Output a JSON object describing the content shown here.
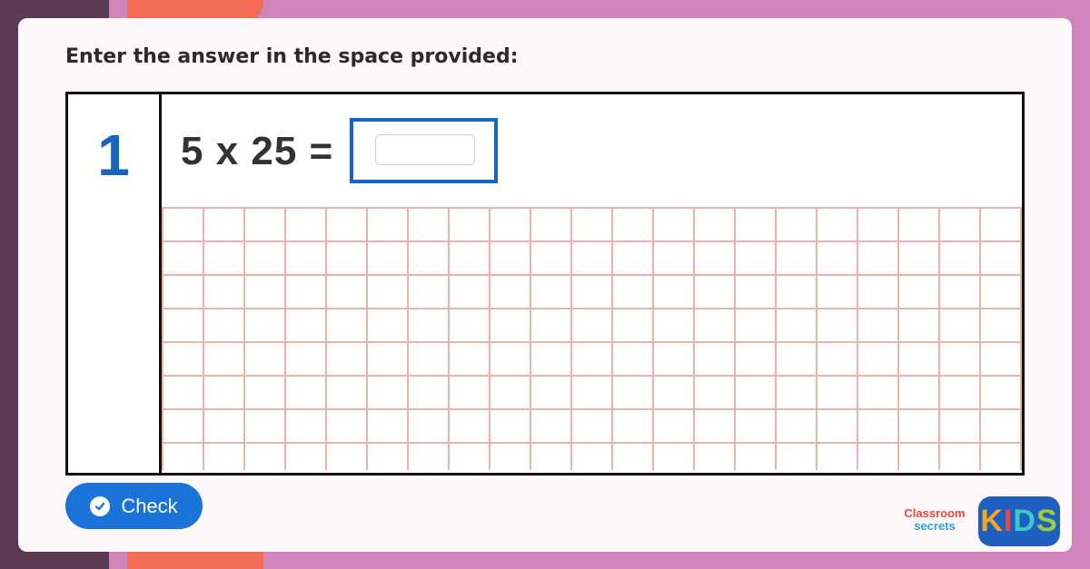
{
  "prompt": "Enter the answer in the space provided:",
  "question": {
    "number": "1",
    "equation": "5 x 25 =",
    "answer_value": "",
    "answer_placeholder": ""
  },
  "check_button": {
    "label": "Check",
    "icon": "check-circle-icon"
  },
  "logo": {
    "line1": "Classroom",
    "line2": "secrets",
    "kids_letters": [
      "K",
      "I",
      "D",
      "S"
    ]
  },
  "colors": {
    "background": "#d084ba",
    "accent_blue": "#1565c0",
    "button_blue": "#1a73d8",
    "grid_lines": "#e6b3b0",
    "orange": "#f26b57",
    "dark_purple": "#5b3a53"
  }
}
